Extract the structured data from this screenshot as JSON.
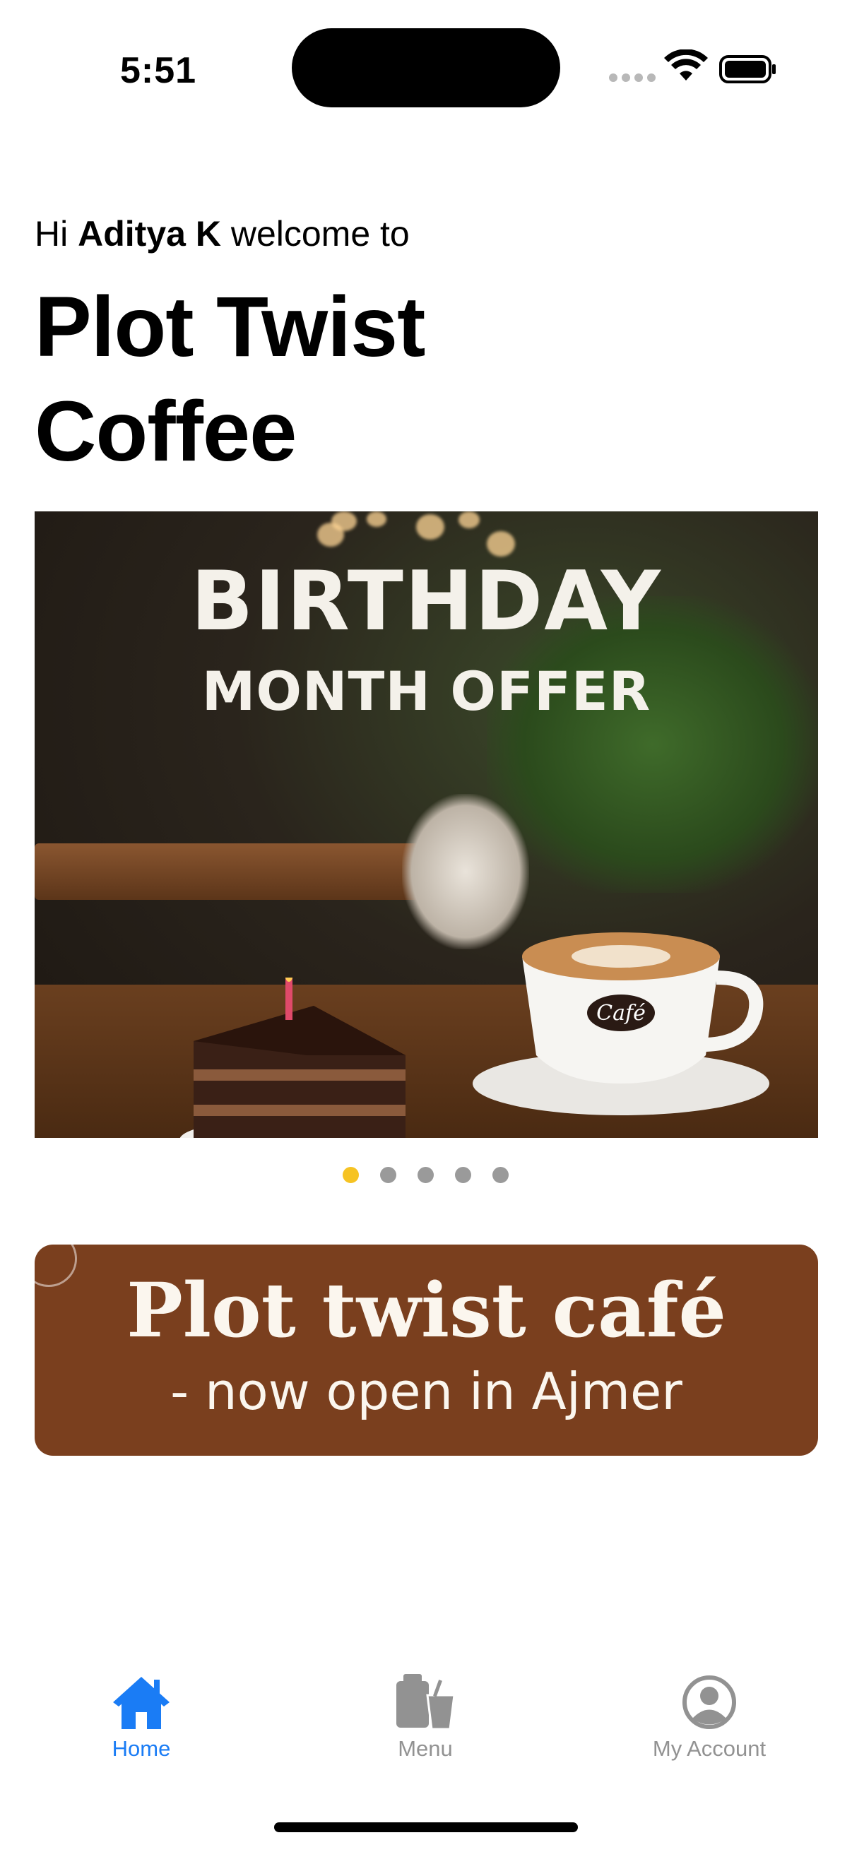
{
  "status_bar": {
    "time": "5:51"
  },
  "greeting": {
    "prefix": "Hi",
    "name": "Aditya K",
    "suffix": "welcome to"
  },
  "brand": {
    "title": "Plot Twist Coffee"
  },
  "promo_banner": {
    "title": "BIRTHDAY",
    "subtitle": "MONTH OFFER",
    "cup_label": "Café"
  },
  "carousel": {
    "total": 5,
    "active_index": 0,
    "active_color": "#f6c323",
    "inactive_color": "#9a9a9a"
  },
  "second_banner": {
    "title": "Plot twist café",
    "subtitle": "- now open in Ajmer",
    "background": "#7a3f1e"
  },
  "tab_bar": {
    "items": [
      {
        "label": "Home",
        "icon": "house-icon",
        "selected": true
      },
      {
        "label": "Menu",
        "icon": "takeaway-cup-icon",
        "selected": false
      },
      {
        "label": "My Account",
        "icon": "person-circle-icon",
        "selected": false
      }
    ],
    "accent_color": "#1a7cf5"
  }
}
